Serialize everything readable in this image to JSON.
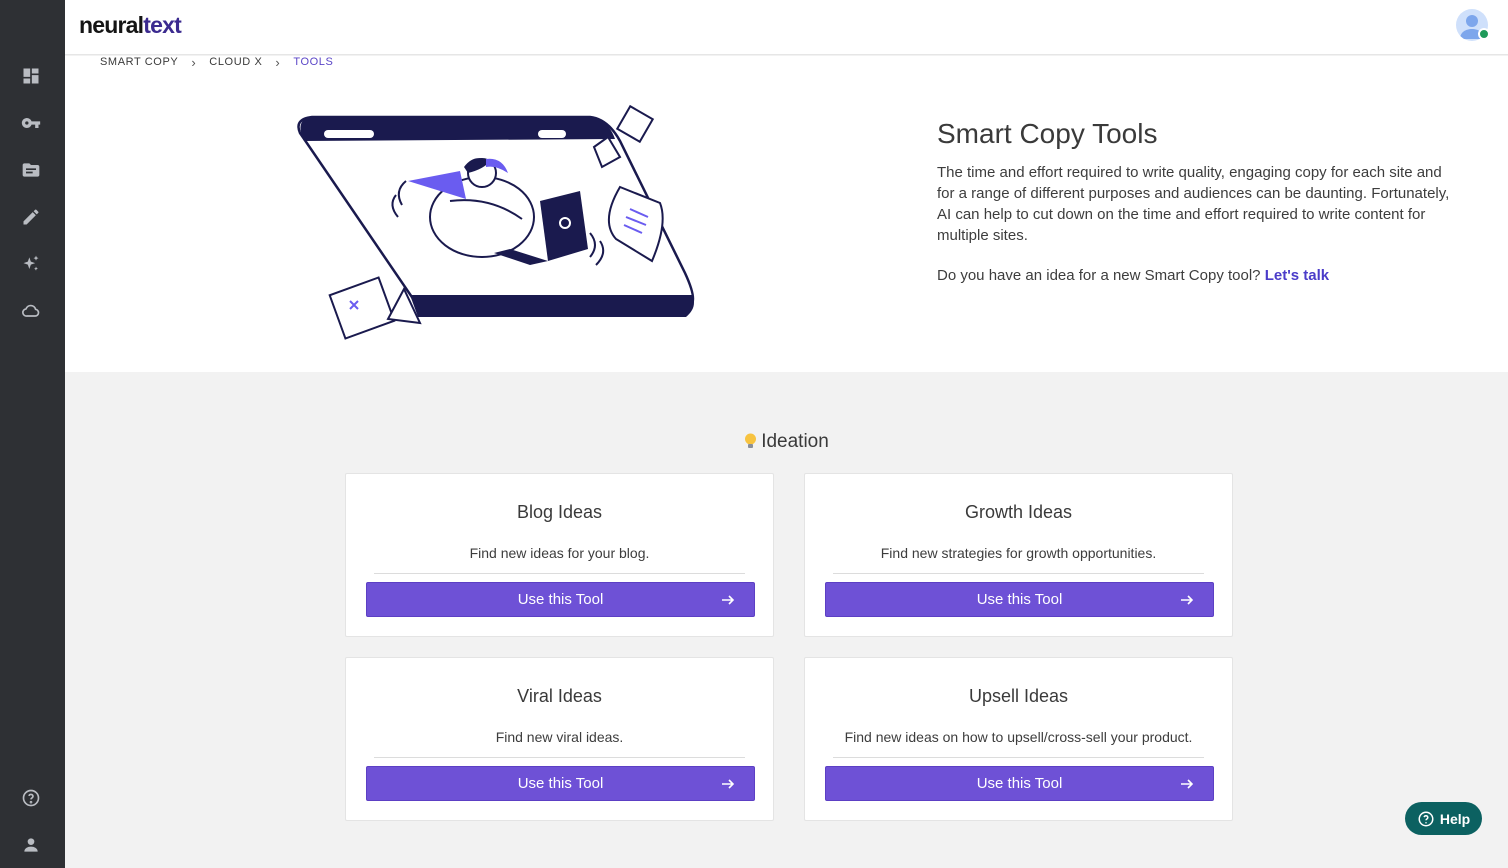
{
  "brand": {
    "part1": "neural",
    "part2": "text"
  },
  "sidebar": {
    "top_icons": [
      "dashboard-icon",
      "key-icon",
      "folder-icon",
      "pencil-icon",
      "sparkles-icon",
      "cloud-icon"
    ],
    "bottom_icons": [
      "help-circle-icon",
      "user-icon"
    ]
  },
  "breadcrumb": [
    {
      "label": "SMART COPY"
    },
    {
      "label": "CLOUD X"
    },
    {
      "label": "TOOLS"
    }
  ],
  "hero": {
    "title": "Smart Copy Tools",
    "description": "The time and effort required to write quality, engaging copy for each site and for a range of different purposes and audiences can be daunting. Fortunately, AI can help to cut down on the time and effort required to write content for multiple sites.",
    "question": "Do you have an idea for a new Smart Copy tool?",
    "link": "Let's talk"
  },
  "section": {
    "title": "Ideation",
    "icon": "lightbulb-icon"
  },
  "cards": [
    {
      "title": "Blog Ideas",
      "description": "Find new ideas for your blog.",
      "button": "Use this Tool"
    },
    {
      "title": "Growth Ideas",
      "description": "Find new strategies for growth opportunities.",
      "button": "Use this Tool"
    },
    {
      "title": "Viral Ideas",
      "description": "Find new viral ideas.",
      "button": "Use this Tool"
    },
    {
      "title": "Upsell Ideas",
      "description": "Find new ideas on how to upsell/cross-sell your product.",
      "button": "Use this Tool"
    }
  ],
  "help": {
    "label": "Help"
  },
  "colors": {
    "accent": "#6e51d6",
    "sidebar": "#2e3034",
    "help": "#0c6161",
    "link": "#4b3cc9"
  }
}
